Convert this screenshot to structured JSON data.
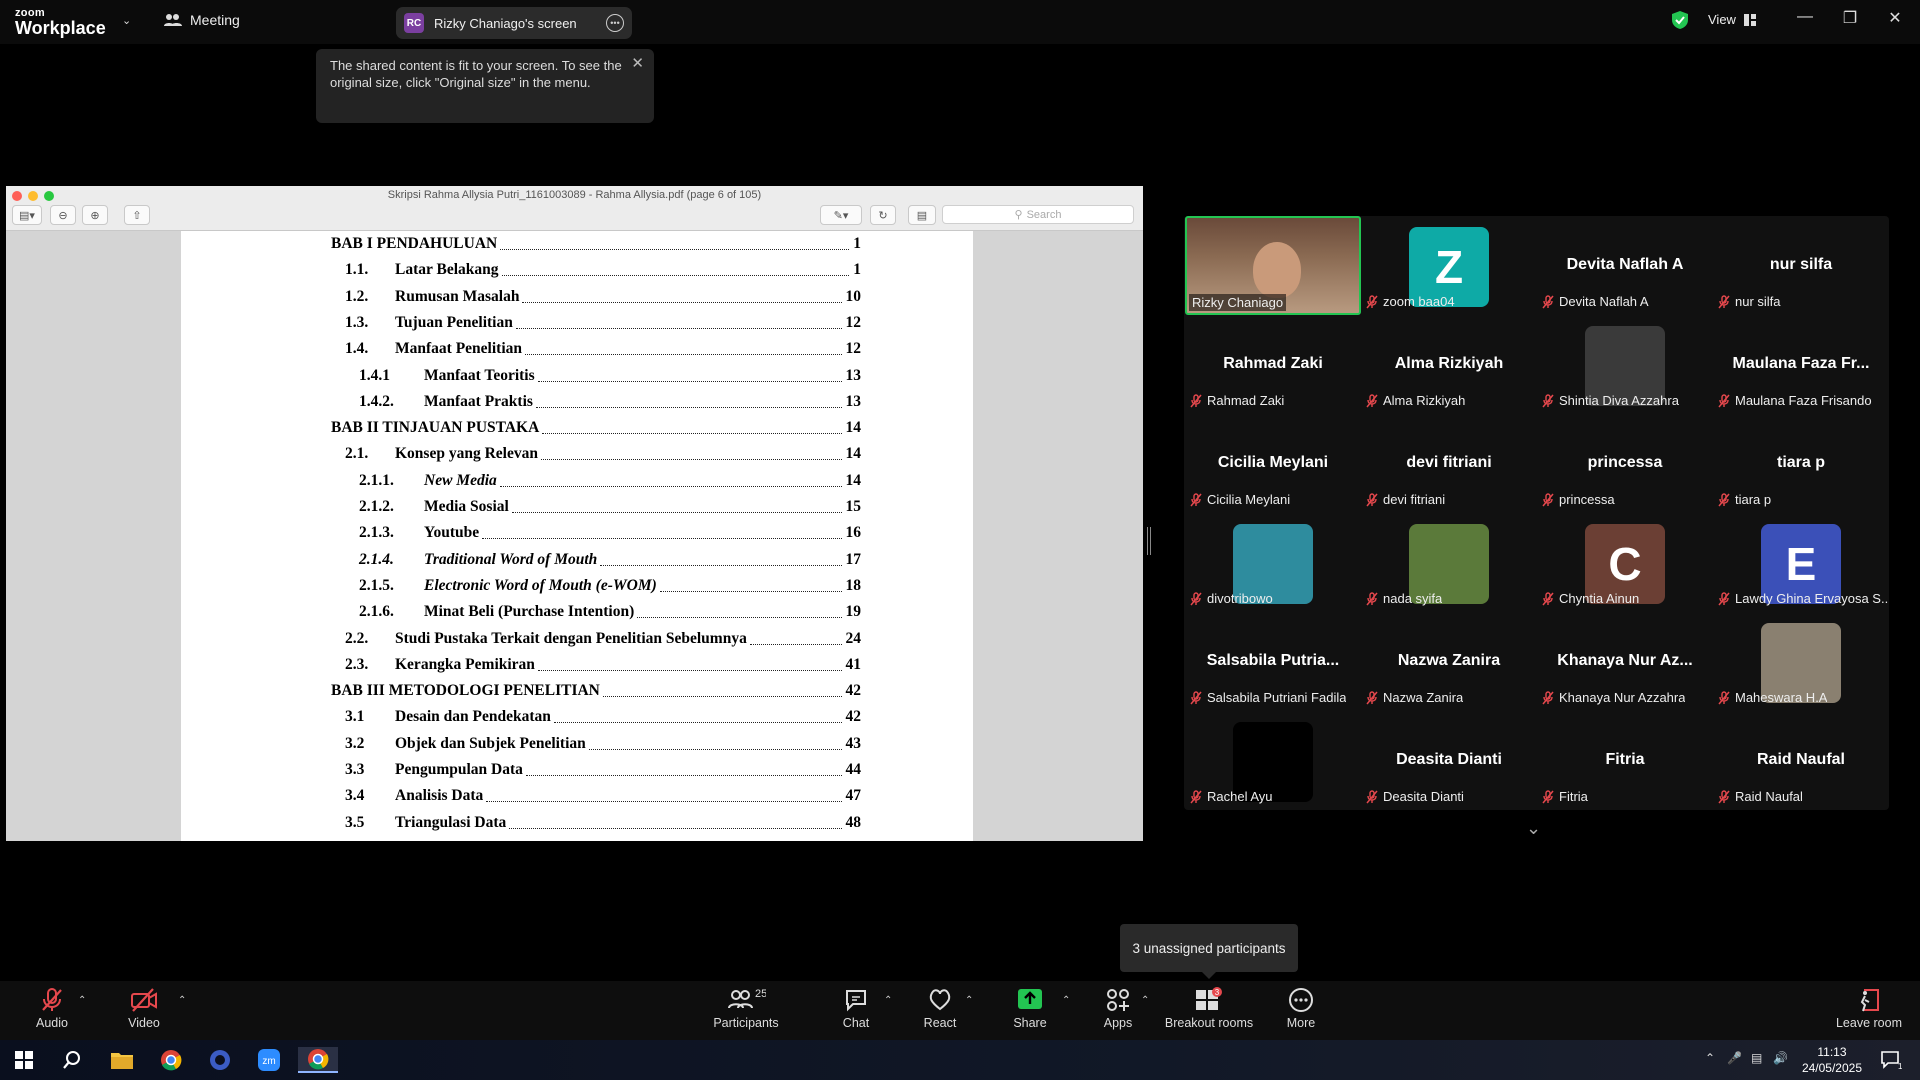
{
  "app": {
    "logo_top": "zoom",
    "logo_bottom": "Workplace",
    "meeting_label": "Meeting"
  },
  "share_pill": {
    "initials": "RC",
    "name": "Rizky Chaniago's screen"
  },
  "tooltip": {
    "text": "The shared content is fit to your screen. To see the original size, click \"Original size\" in the menu."
  },
  "view": {
    "label": "View"
  },
  "shared_window": {
    "title": "Skripsi Rahma Allysia Putri_1161003089 - Rahma Allysia.pdf (page 6 of 105)",
    "search_placeholder": "Search",
    "toc": [
      {
        "num": "",
        "text": "BAB I PENDAHULUAN",
        "page": "1",
        "level": 0
      },
      {
        "num": "1.1.",
        "text": "Latar Belakang",
        "page": "1",
        "level": 1
      },
      {
        "num": "1.2.",
        "text": "Rumusan Masalah",
        "page": "10",
        "level": 1
      },
      {
        "num": "1.3.",
        "text": "Tujuan Penelitian",
        "page": "12",
        "level": 1
      },
      {
        "num": "1.4.",
        "text": "Manfaat Penelitian",
        "page": "12",
        "level": 1
      },
      {
        "num": "1.4.1",
        "text": "Manfaat Teoritis",
        "page": "13",
        "level": 2
      },
      {
        "num": "1.4.2.",
        "text": "Manfaat Praktis",
        "page": "13",
        "level": 2
      },
      {
        "num": "",
        "text": "BAB II TINJAUAN PUSTAKA",
        "page": "14",
        "level": 0
      },
      {
        "num": "2.1.",
        "text": "Konsep yang Relevan",
        "page": "14",
        "level": 1
      },
      {
        "num": "2.1.1.",
        "text": "New Media",
        "page": "14",
        "level": 2,
        "italic": true
      },
      {
        "num": "2.1.2.",
        "text": "Media Sosial",
        "page": "15",
        "level": 2
      },
      {
        "num": "2.1.3.",
        "text": "Youtube",
        "page": "16",
        "level": 2
      },
      {
        "num": "2.1.4.",
        "text": "Traditional Word of Mouth",
        "page": "17",
        "level": 2,
        "italic": true,
        "italic_num": true
      },
      {
        "num": "2.1.5.",
        "text": "Electronic Word of Mouth (e-WOM)",
        "page": "18",
        "level": 2,
        "italic": true
      },
      {
        "num": "2.1.6.",
        "text": "Minat Beli (Purchase Intention)",
        "page": "19",
        "level": 2
      },
      {
        "num": "2.2.",
        "text": "Studi Pustaka Terkait dengan Penelitian Sebelumnya",
        "page": "24",
        "level": 1
      },
      {
        "num": "2.3.",
        "text": "Kerangka Pemikiran",
        "page": "41",
        "level": 1
      },
      {
        "num": "",
        "text": "BAB III METODOLOGI PENELITIAN",
        "page": "42",
        "level": 0
      },
      {
        "num": "3.1",
        "text": "Desain dan Pendekatan",
        "page": "42",
        "level": 1
      },
      {
        "num": "3.2",
        "text": "Objek dan Subjek Penelitian",
        "page": "43",
        "level": 1
      },
      {
        "num": "3.3",
        "text": "Pengumpulan Data",
        "page": "44",
        "level": 1
      },
      {
        "num": "3.4",
        "text": "Analisis Data",
        "page": "47",
        "level": 1
      },
      {
        "num": "3.5",
        "text": "Triangulasi Data",
        "page": "48",
        "level": 1
      }
    ]
  },
  "participants": [
    {
      "big": "",
      "label": "Rizky Chaniago",
      "type": "video",
      "active": true
    },
    {
      "big": "Z",
      "label": "zoom baa04",
      "type": "square",
      "color": "#0eaaa6"
    },
    {
      "big": "Devita Naflah A",
      "label": "Devita Naflah A",
      "type": "name"
    },
    {
      "big": "nur silfa",
      "label": "nur silfa",
      "type": "name"
    },
    {
      "big": "Rahmad Zaki",
      "label": "Rahmad Zaki",
      "type": "name"
    },
    {
      "big": "Alma Rizkiyah",
      "label": "Alma Rizkiyah",
      "type": "name"
    },
    {
      "big": "",
      "label": "Shintia Diva Azzahra",
      "type": "photo",
      "color": "#3a3a3a"
    },
    {
      "big": "Maulana Faza Fr...",
      "label": "Maulana Faza Frisando",
      "type": "name"
    },
    {
      "big": "Cicilia Meylani",
      "label": "Cicilia Meylani",
      "type": "name"
    },
    {
      "big": "devi fitriani",
      "label": "devi fitriani",
      "type": "name"
    },
    {
      "big": "princessa",
      "label": "princessa",
      "type": "name"
    },
    {
      "big": "tiara p",
      "label": "tiara p",
      "type": "name"
    },
    {
      "big": "",
      "label": "divotribowo",
      "type": "square",
      "color": "#2e8c9e"
    },
    {
      "big": "",
      "label": "nada syifa",
      "type": "photo",
      "color": "#5b7a3a"
    },
    {
      "big": "C",
      "label": "Chyntia Ainun",
      "type": "square",
      "color": "#6b3f34"
    },
    {
      "big": "E",
      "label": "Lawdy Ghina Ervayosa S...",
      "type": "square",
      "color": "#3b50b8"
    },
    {
      "big": "Salsabila  Putria...",
      "label": "Salsabila Putriani Fadila",
      "type": "name"
    },
    {
      "big": "Nazwa Zanira",
      "label": "Nazwa Zanira",
      "type": "name"
    },
    {
      "big": "Khanaya Nur Az...",
      "label": "Khanaya Nur Azzahra",
      "type": "name"
    },
    {
      "big": "",
      "label": "Maheswara H.A",
      "type": "photo",
      "color": "#8a8070"
    },
    {
      "big": "",
      "label": "Rachel Ayu",
      "type": "square",
      "color": "#000000"
    },
    {
      "big": "Deasita Dianti",
      "label": "Deasita Dianti",
      "type": "name"
    },
    {
      "big": "Fitria",
      "label": "Fitria",
      "type": "name"
    },
    {
      "big": "Raid Naufal",
      "label": "Raid Naufal",
      "type": "name"
    }
  ],
  "unassigned": "3 unassigned participants",
  "toolbar": {
    "audio": "Audio",
    "video": "Video",
    "participants": "Participants",
    "participants_count": "25",
    "chat": "Chat",
    "react": "React",
    "share": "Share",
    "apps": "Apps",
    "breakout": "Breakout rooms",
    "breakout_badge": "3",
    "more": "More",
    "leave": "Leave room"
  },
  "taskbar": {
    "time": "11:13",
    "date": "24/05/2025",
    "notif_count": "1"
  },
  "colors": {
    "accent_green": "#23c552",
    "active_border": "#23c552",
    "mute_red": "#e5484d"
  }
}
